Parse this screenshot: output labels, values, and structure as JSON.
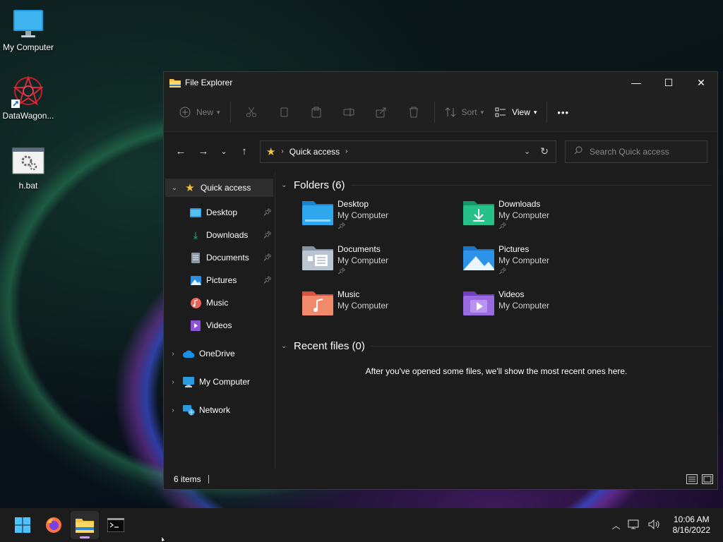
{
  "desktop": {
    "icons": [
      {
        "label": "My Computer"
      },
      {
        "label": "DataWagon..."
      },
      {
        "label": "h.bat"
      }
    ]
  },
  "window": {
    "title": "File Explorer",
    "controls": {
      "minimize": "—",
      "maximize": "☐",
      "close": "✕"
    }
  },
  "toolbar": {
    "new_label": "New",
    "sort_label": "Sort",
    "view_label": "View",
    "more_label": "•••"
  },
  "address": {
    "path": "Quick access",
    "search_placeholder": "Search Quick access"
  },
  "nav": {
    "quick_access": "Quick access",
    "pinned": [
      {
        "label": "Desktop",
        "pinned": true
      },
      {
        "label": "Downloads",
        "pinned": true
      },
      {
        "label": "Documents",
        "pinned": true
      },
      {
        "label": "Pictures",
        "pinned": true
      },
      {
        "label": "Music",
        "pinned": false
      },
      {
        "label": "Videos",
        "pinned": false
      }
    ],
    "onedrive": "OneDrive",
    "my_computer": "My Computer",
    "network": "Network"
  },
  "content": {
    "folders_header": "Folders (6)",
    "folders": [
      {
        "name": "Desktop",
        "location": "My Computer",
        "pinned": true
      },
      {
        "name": "Downloads",
        "location": "My Computer",
        "pinned": true
      },
      {
        "name": "Documents",
        "location": "My Computer",
        "pinned": true
      },
      {
        "name": "Pictures",
        "location": "My Computer",
        "pinned": true
      },
      {
        "name": "Music",
        "location": "My Computer",
        "pinned": false
      },
      {
        "name": "Videos",
        "location": "My Computer",
        "pinned": false
      }
    ],
    "recent_header": "Recent files (0)",
    "recent_empty": "After you've opened some files, we'll show the most recent ones here."
  },
  "status": {
    "items": "6 items"
  },
  "taskbar": {
    "time": "10:06 AM",
    "date": "8/16/2022"
  },
  "colors": {
    "accent": "#3a8fd8",
    "window_bg": "#1c1c1c",
    "taskbar_bg": "#1c1c1c"
  }
}
